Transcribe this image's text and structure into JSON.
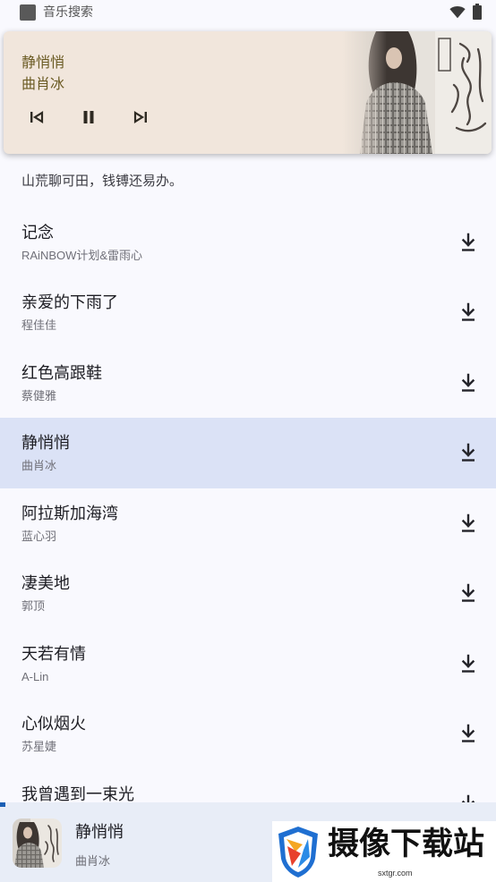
{
  "status_bar": {
    "app_name": "音乐搜索",
    "icons": [
      "app-icon",
      "wifi-icon",
      "battery-icon"
    ]
  },
  "media_notification": {
    "title": "静悄悄",
    "artist": "曲肖冰",
    "controls": [
      "skip-previous-icon",
      "pause-icon",
      "skip-next-icon"
    ]
  },
  "header": {
    "subtitle": "山荒聊可田，钱镈还易办。"
  },
  "songs": [
    {
      "title": "记念",
      "artist": "RAiNBOW计划&雷雨心"
    },
    {
      "title": "亲爱的下雨了",
      "artist": "程佳佳"
    },
    {
      "title": "红色高跟鞋",
      "artist": "蔡健雅"
    },
    {
      "title": "静悄悄",
      "artist": "曲肖冰",
      "selected": true
    },
    {
      "title": "阿拉斯加海湾",
      "artist": "蓝心羽"
    },
    {
      "title": "凄美地",
      "artist": "郭顶"
    },
    {
      "title": "天若有情",
      "artist": "A-Lin"
    },
    {
      "title": "心似烟火",
      "artist": "苏星婕"
    },
    {
      "title": "我曾遇到一束光"
    }
  ],
  "row_action_icon": "download-icon",
  "now_playing": {
    "title": "静悄悄",
    "artist": "曲肖冰",
    "progress": 0.01
  },
  "watermark": {
    "name": "摄像下载站",
    "site": "sxtgr.com"
  },
  "colors": {
    "background": "#f9f9fe",
    "notification_bg": "#f1e6dc",
    "notification_text": "#6a5a22",
    "selected_row": "#dbe2f6",
    "player_bar": "#e8edf7",
    "progress": "#1a5fb4"
  }
}
